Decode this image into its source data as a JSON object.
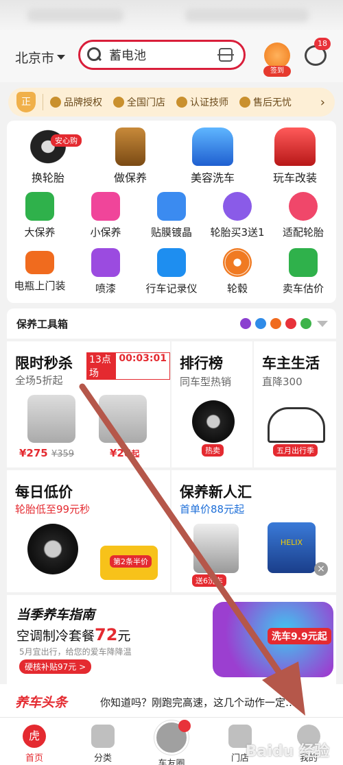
{
  "header": {
    "city": "北京市",
    "search_value": "蓄电池",
    "signin_label": "签到",
    "msg_count": "18"
  },
  "trust": {
    "badge": "正",
    "items": [
      "品牌授权",
      "全国门店",
      "认证技师",
      "售后无忧"
    ],
    "arrow": "›"
  },
  "main_services": [
    {
      "label": "换轮胎",
      "tag": "安心购"
    },
    {
      "label": "做保养"
    },
    {
      "label": "美容洗车"
    },
    {
      "label": "玩车改装"
    }
  ],
  "services_row1": [
    "大保养",
    "小保养",
    "贴膜镀晶",
    "轮胎买3送1",
    "适配轮胎"
  ],
  "services_row2": [
    "电瓶上门装",
    "喷漆",
    "行车记录仪",
    "轮毂",
    "卖车估价"
  ],
  "tools": {
    "title": "保养工具箱"
  },
  "flash": {
    "title": "限时秒杀",
    "session": "13点场",
    "timer": "00:03:01",
    "sub": "全场5折起",
    "price1": "¥275",
    "orig1": "¥359",
    "price2": "¥2",
    "price2_tail": "8",
    "price2_suffix": "起"
  },
  "rank": {
    "title": "排行榜",
    "sub": "同车型热销",
    "badge": "热卖"
  },
  "life": {
    "title": "车主生活",
    "sub": "直降300",
    "badge": "五月出行季"
  },
  "daily": {
    "title": "每日低价",
    "sub": "轮胎低至99元秒",
    "badge": "第2条半价"
  },
  "newcomer": {
    "title": "保养新人汇",
    "sub": "首单价88元起",
    "badge": "送6",
    "badge_tail": "洗车",
    "brand1": "HELIX"
  },
  "guide": {
    "title": "当季养车指南",
    "headline_prefix": "空调制冷套餐",
    "headline_price": "72",
    "headline_suffix": "元",
    "note": "5月宜出行，给您的爱车降降温",
    "btn": "硬核补贴97元 >",
    "promo": "洗车9.9元起"
  },
  "news": {
    "label": "养车头条",
    "text": "你知道吗？刚跑完高速，这几个动作一定…"
  },
  "nav": [
    {
      "label": "首页",
      "glyph": "虎"
    },
    {
      "label": "分类"
    },
    {
      "label": "车友圈"
    },
    {
      "label": "门店"
    },
    {
      "label": "我的"
    }
  ],
  "watermark": "Baidu 经验",
  "colors": {
    "brand_red": "#e42a30",
    "arrow": "#b5574a"
  }
}
